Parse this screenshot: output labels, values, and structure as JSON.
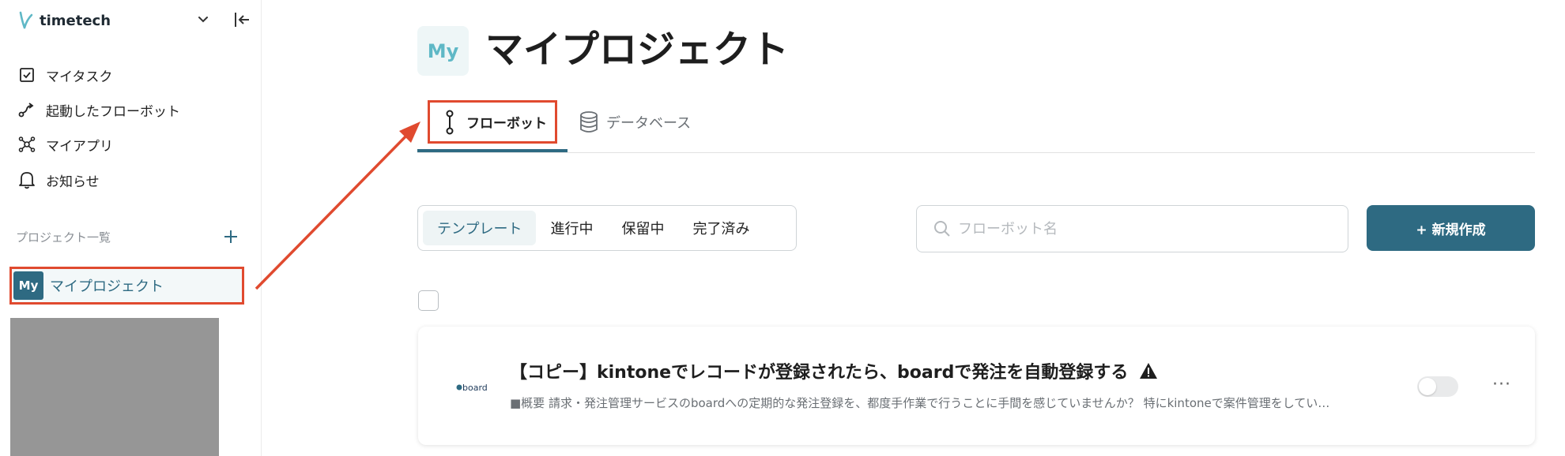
{
  "sidebar": {
    "brand": "timetech",
    "nav": [
      {
        "label": "マイタスク",
        "icon": "checkbox-icon"
      },
      {
        "label": "起動したフローボット",
        "icon": "flow-launch-icon"
      },
      {
        "label": "マイアプリ",
        "icon": "apps-network-icon"
      },
      {
        "label": "お知らせ",
        "icon": "bell-icon"
      }
    ],
    "section_label": "プロジェクト一覧",
    "project": {
      "avatar": "My",
      "name": "マイプロジェクト"
    }
  },
  "main": {
    "avatar": "My",
    "title": "マイプロジェクト",
    "tabs": [
      {
        "label": "フローボット",
        "icon": "flowbot-icon",
        "active": true
      },
      {
        "label": "データベース",
        "icon": "database-icon",
        "active": false
      }
    ],
    "filters": [
      "テンプレート",
      "進行中",
      "保留中",
      "完了済み"
    ],
    "active_filter": "テンプレート",
    "search": {
      "placeholder": "フローボット名",
      "value": ""
    },
    "new_button": "+ 新規作成",
    "cards": [
      {
        "logo": "board",
        "title": "【コピー】kintoneでレコードが登録されたら、boardで発注を自動登録する",
        "description": "■概要 請求・発注管理サービスのboardへの定期的な発注登録を、都度手作業で行うことに手間を感じていませんか？ 特にkintoneで案件管理をしてい…",
        "enabled": false,
        "warning": true
      }
    ]
  },
  "colors": {
    "accent": "#2e6a82",
    "highlight": "#e04a2f",
    "brand_teal": "#5fb8c6"
  }
}
